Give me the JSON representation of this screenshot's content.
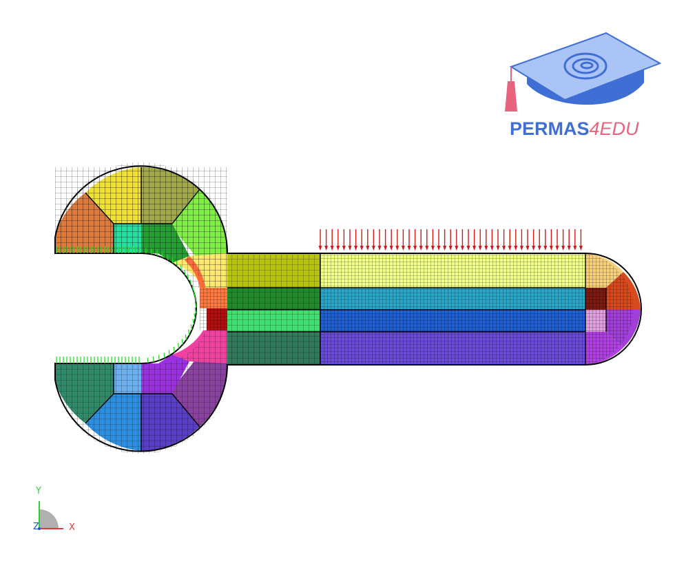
{
  "logo": {
    "name_part1": "PERMAS",
    "name_part2": "4EDU",
    "colors": {
      "primary": "#3f6fd4",
      "accent": "#e8647e",
      "light": "#a9c4f5"
    }
  },
  "triad": {
    "x_label": "X",
    "y_label": "Y",
    "z_label": "Z",
    "colors": {
      "x": "#e53935",
      "y": "#2ecc40",
      "z": "#1e4fd8"
    }
  },
  "model": {
    "load_color": "#d01818",
    "support_color": "#22dd22",
    "edge_color": "#000000",
    "part_colors": {
      "upper_left": "#e07a3a",
      "upper_top_left": "#f0e030",
      "upper_top_right": "#a0a848",
      "upper_right": "#7ff040",
      "lower_left": "#2f8a6a",
      "lower_bottom_left": "#2a8fe0",
      "lower_bottom_right": "#5a3ec8",
      "lower_right": "#8a40a0",
      "bar_top": "#f2ff8a",
      "bar_mid1": "#2ca6c8",
      "bar_mid2": "#1f5fd0",
      "bar_bottom": "#6a4bd6",
      "tip_top": "#f6d07a",
      "tip_mid": "#d64a1e",
      "tip_bottom": "#a040d8"
    }
  }
}
